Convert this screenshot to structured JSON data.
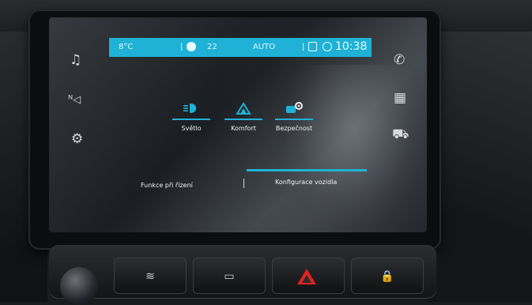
{
  "status_bar": {
    "temp_left": "8°C",
    "fan_bars": "|",
    "temp_right": "22",
    "climate_mode": "AUTO",
    "separator": "|",
    "time": "10:38"
  },
  "side_menu_left": {
    "items": [
      {
        "icon": "music-note-icon",
        "glyph": "♫"
      },
      {
        "icon": "navigation-icon",
        "glyph": "ᴺ◁"
      },
      {
        "icon": "settings-car-icon",
        "glyph": "⚙"
      }
    ]
  },
  "side_menu_right": {
    "items": [
      {
        "icon": "phone-icon",
        "glyph": "✆"
      },
      {
        "icon": "apps-grid-icon",
        "glyph": "▦"
      },
      {
        "icon": "car-icon",
        "glyph": "⛟"
      }
    ]
  },
  "tiles": [
    {
      "label": "Světlo",
      "icon": "headlight-icon",
      "glyph": "▶≡"
    },
    {
      "label": "Komfort",
      "icon": "comfort-icon",
      "glyph": "△"
    },
    {
      "label": "Bezpečnost",
      "icon": "safety-icon",
      "glyph": "■⚙"
    }
  ],
  "tabs": {
    "left": "Funkce při řízení",
    "right": "Konfigurace vozidla",
    "active": "right",
    "divider": "|"
  },
  "physical_buttons": [
    {
      "icon": "rear-defrost-icon",
      "glyph": "≋"
    },
    {
      "icon": "front-defrost-icon",
      "glyph": "▭"
    },
    {
      "icon": "hazard-icon",
      "glyph": ""
    },
    {
      "icon": "door-lock-icon",
      "glyph": "🔒"
    }
  ],
  "colors": {
    "accent": "#1fb2d6",
    "hazard": "#e0221f"
  }
}
